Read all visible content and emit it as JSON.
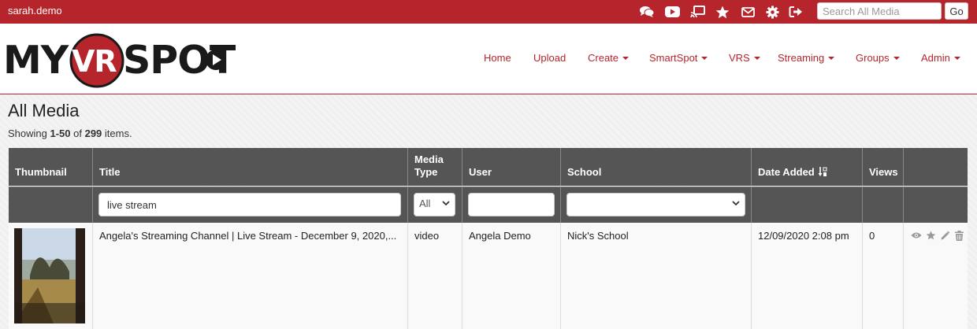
{
  "topbar": {
    "username": "sarah.demo",
    "icons": [
      "chat-icon",
      "youtube-icon",
      "cast-icon",
      "star-icon",
      "envelope-icon",
      "gear-icon",
      "sign-out-icon"
    ],
    "search_placeholder": "Search All Media",
    "search_value": "",
    "go_label": "Go",
    "bar_color": "#b5252b"
  },
  "brand": {
    "logo_left": "MY",
    "logo_mid": "VR",
    "logo_right": "SPOT"
  },
  "nav": {
    "items": [
      {
        "label": "Home",
        "dropdown": false
      },
      {
        "label": "Upload",
        "dropdown": false
      },
      {
        "label": "Create",
        "dropdown": true
      },
      {
        "label": "SmartSpot",
        "dropdown": true
      },
      {
        "label": "VRS",
        "dropdown": true
      },
      {
        "label": "Streaming",
        "dropdown": true
      },
      {
        "label": "Groups",
        "dropdown": true
      },
      {
        "label": "Admin",
        "dropdown": true
      }
    ]
  },
  "page": {
    "title": "All Media",
    "summary_prefix": "Showing ",
    "summary_range": "1-50",
    "summary_of": " of ",
    "summary_total": "299",
    "summary_suffix": " items."
  },
  "table": {
    "headers": {
      "thumbnail": "Thumbnail",
      "title": "Title",
      "media_type_line1": "Media",
      "media_type_line2": "Type",
      "user": "User",
      "school": "School",
      "date_added": "Date Added",
      "views": "Views"
    },
    "filters": {
      "title_value": "live stream",
      "media_type_value": "All",
      "user_value": "",
      "school_value": ""
    },
    "rows": [
      {
        "title": "Angela's Streaming Channel | Live Stream - December 9, 2020,...",
        "media_type": "video",
        "user": "Angela Demo",
        "school": "Nick's School",
        "date_added": "12/09/2020 2:08 pm",
        "views": "0"
      }
    ]
  }
}
